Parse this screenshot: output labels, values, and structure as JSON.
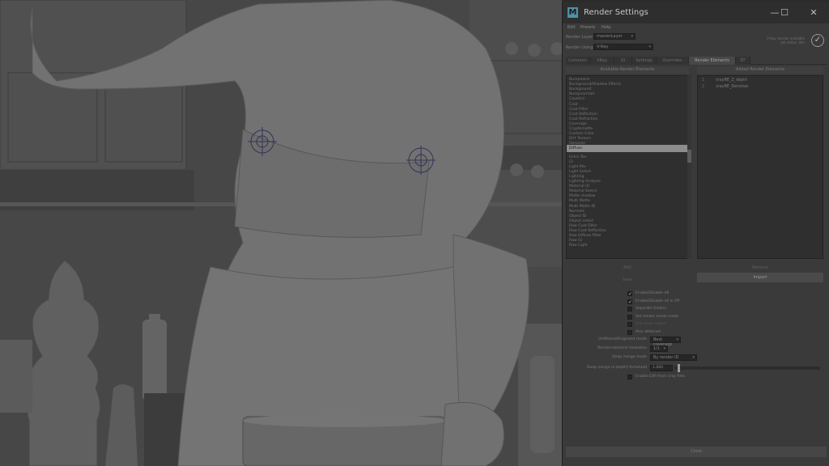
{
  "window": {
    "title": "Render Settings",
    "app_icon": "M",
    "minimize": "—",
    "maximize": "☐",
    "close": "✕"
  },
  "menu": [
    "Edit",
    "Presets",
    "Help"
  ],
  "render_layer": {
    "label": "Render Layer",
    "value": "masterLayer"
  },
  "render_using": {
    "label": "Render Using",
    "value": "V-Ray"
  },
  "status": {
    "line1": "V-Ray session available",
    "line2": "Job status: Idle"
  },
  "tabs": [
    "Common",
    "VRay",
    "GI",
    "Settings",
    "Overrides",
    "Render Elements",
    "RT"
  ],
  "panes": {
    "available_header": "Available Render Elements",
    "active_header": "Added Render Elements"
  },
  "available_elements": [
    "Bumpnorm",
    "Background/Shadow Effects",
    "Background",
    "Bumpnormals",
    "Caustics",
    "Coat",
    "Coat Filter",
    "Coat Reflection",
    "Coat Refraction",
    "Coverage",
    "Cryptomatte",
    "Custom Color",
    "Dirt Texture",
    "Denoiser",
    "Diffuse",
    "Extra Tex",
    "GI",
    "Light Mix",
    "Light Select",
    "Lighting",
    "Lighting Analysis",
    "Material ID",
    "Material Select",
    "Matte shadow",
    "Multi Matte",
    "Multi Matte ID",
    "Normals",
    "Object ID",
    "Object select",
    "Raw Coat Filter",
    "Raw Coat Reflection",
    "Raw Diffuse Filter",
    "Raw GI",
    "Raw Light"
  ],
  "selected_available_index": 14,
  "active_elements": [
    {
      "index": "1",
      "name": "vrayRE_Z_depth"
    },
    {
      "index": "2",
      "name": "vrayRE_Denoiser"
    }
  ],
  "buttons": {
    "left_top": "Add",
    "right_top": "Remove",
    "left_bottom": "Save",
    "right_bottom": "Import"
  },
  "checks": [
    {
      "label": "Enable/Disable All",
      "checked": true,
      "disabled": false
    },
    {
      "label": "Enable/Disable all in VP",
      "checked": true,
      "disabled": false
    },
    {
      "label": "Separate folders",
      "checked": false,
      "disabled": false
    },
    {
      "label": "Set render mode mode",
      "checked": false,
      "disabled": false
    },
    {
      "label": "Use deep output",
      "checked": false,
      "disabled": true
    },
    {
      "label": "Also deferred",
      "checked": false,
      "disabled": false
    }
  ],
  "fields": {
    "mode": {
      "label": "Unfiltered/fragment mode",
      "value": "Best coverage"
    },
    "resolution": {
      "label": "Render-element resolution",
      "value": "1/1"
    },
    "merge": {
      "label": "Deep merge mode",
      "value": "By render ID"
    },
    "threshold": {
      "label": "Deep merge (z-depth) threshold",
      "value": "1.000"
    },
    "exr": {
      "label": "Enable EXR from vray files"
    }
  },
  "slider_level": 0.02,
  "close_label": "Close"
}
